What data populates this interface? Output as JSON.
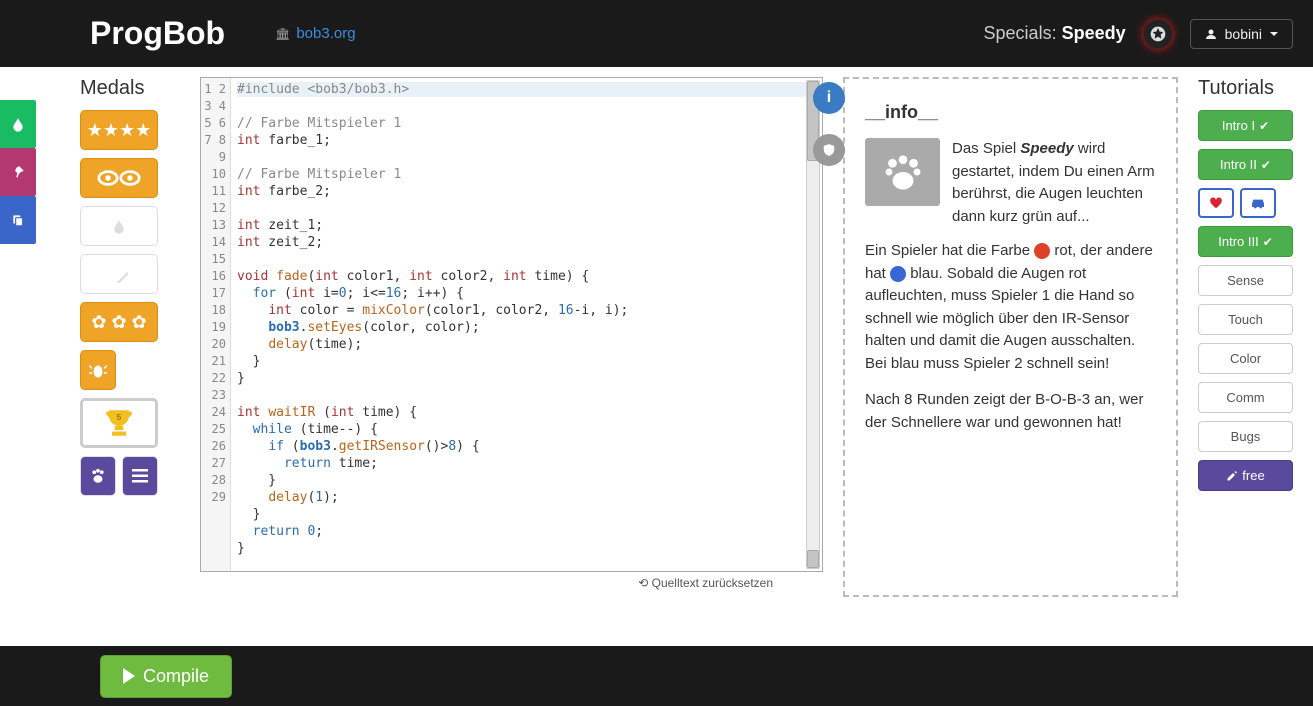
{
  "header": {
    "logo": "ProgBob",
    "site_link": "bob3.org",
    "specials_label": "Specials:",
    "specials_name": "Speedy",
    "user": "bobini"
  },
  "medals": {
    "title": "Medals",
    "trophy_badge": "5"
  },
  "editor": {
    "reset_label": "⟲ Quelltext zurücksetzen",
    "lines": [
      "1",
      "2",
      "3",
      "4",
      "5",
      "6",
      "7",
      "8",
      "9",
      "10",
      "11",
      "12",
      "13",
      "14",
      "15",
      "16",
      "17",
      "18",
      "19",
      "20",
      "21",
      "22",
      "23",
      "24",
      "25",
      "26",
      "27",
      "28",
      "29"
    ]
  },
  "info": {
    "title": "__info__",
    "para1_prefix": "Das Spiel ",
    "para1_em": "Speedy",
    "para1_suffix": " wird gestartet, indem Du einen Arm berührst, die Augen leuchten dann kurz grün auf...",
    "para2_a": "Ein Spieler hat die Farbe ",
    "para2_b": " rot, der andere hat ",
    "para2_c": " blau. Sobald die Augen rot aufleuchten, muss Spieler 1 die Hand so schnell wie möglich über den IR-Sensor halten und damit die Augen ausschalten. Bei blau muss Spieler 2 schnell sein!",
    "para3": "Nach 8 Runden zeigt der B-O-B-3 an, wer der Schnellere war und gewonnen hat!"
  },
  "tutorials": {
    "title": "Tutorials",
    "items": {
      "intro1": "Intro I",
      "intro2": "Intro II",
      "intro3": "Intro III",
      "sense": "Sense",
      "touch": "Touch",
      "color": "Color",
      "comm": "Comm",
      "bugs": "Bugs",
      "free": "free"
    }
  },
  "footer": {
    "compile": "Compile"
  }
}
